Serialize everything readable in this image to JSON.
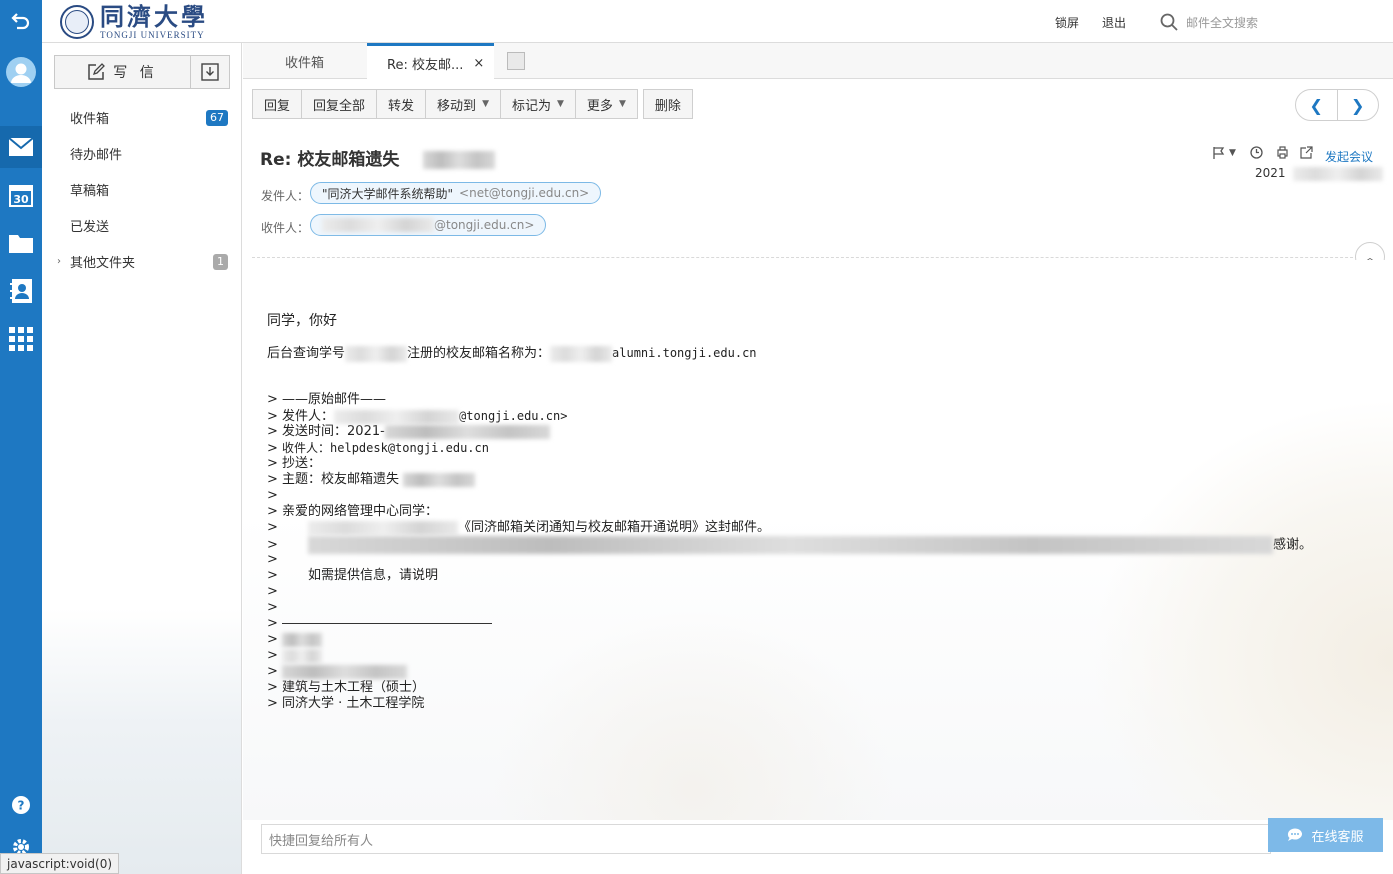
{
  "app": {
    "logo_cn": "同濟大學",
    "logo_en": "TONGJI UNIVERSITY"
  },
  "topbar": {
    "lock_label": "锁屏",
    "logout_label": "退出",
    "search_placeholder": "邮件全文搜索"
  },
  "sidebar": {
    "compose_label": "写 信",
    "folders": [
      {
        "label": "收件箱",
        "count": "67"
      },
      {
        "label": "待办邮件"
      },
      {
        "label": "草稿箱"
      },
      {
        "label": "已发送"
      },
      {
        "label": "其他文件夹",
        "count": "1"
      }
    ]
  },
  "tabs": [
    {
      "label": "收件箱"
    },
    {
      "label": "Re: 校友邮...",
      "close": "×"
    }
  ],
  "toolbar": {
    "reply": "回复",
    "reply_all": "回复全部",
    "forward": "转发",
    "move_to": "移动到",
    "mark_as": "标记为",
    "more": "更多",
    "delete": "删除"
  },
  "message": {
    "subject": "Re: 校友邮箱遗失",
    "from_label": "发件人：",
    "from_name": "\"同济大学邮件系统帮助\"",
    "from_email": "<net@tongji.edu.cn>",
    "to_label": "收件人：",
    "to_email": "@tongji.edu.cn>",
    "start_meeting": "发起会议",
    "date": "2021"
  },
  "body": {
    "greeting": "同学，你好",
    "line2_prefix": "后台查询学号",
    "line2_mid": "注册的校友邮箱名称为：",
    "line2_suffix": "alumni.tongji.edu.cn",
    "quote": {
      "header": "——原始邮件——",
      "from": "发件人：",
      "from_tail": "@tongji.edu.cn>",
      "sent": "发送时间：2021-",
      "to": "收件人：helpdesk@tongji.edu.cn",
      "cc": "抄送：",
      "subject": "主题：校友邮箱遗失",
      "dear": "亲爱的网络管理中心同学：",
      "line_notice": "《同济邮箱关闭通知与校友邮箱开通说明》这封邮件。",
      "line_thanks": "感谢。",
      "line_info": "如需提供信息，请说明",
      "sig_major": "建筑与土木工程（硕士）",
      "sig_school": "同济大学 · 土木工程学院"
    }
  },
  "quick_reply_placeholder": "快捷回复给所有人",
  "online_service": "在线客服",
  "status_bar": "javascript:void(0)"
}
